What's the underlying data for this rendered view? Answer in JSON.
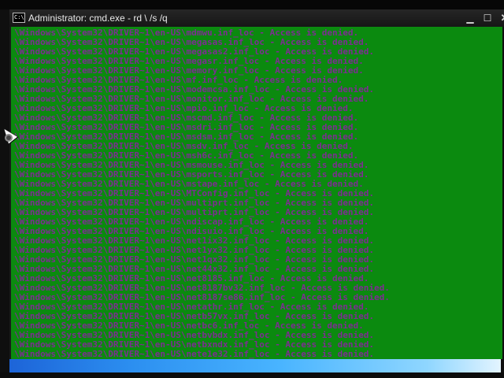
{
  "window": {
    "title": "Administrator: cmd.exe - rd \\ /s /q",
    "icon": "cmd-icon",
    "icon_text": "C:\\",
    "minimize_symbol": "▁",
    "maximize_symbol": "☐",
    "close_symbol": "✕"
  },
  "colors": {
    "console_background": "#0b8a0f",
    "console_text": "#7d2d92",
    "scrollbar_accent": "#49b4ff"
  },
  "console": {
    "lines": [
      "\\Windows\\System32\\DRIVER~1\\en-US\\mdmwu.inf_loc - Access is denied.",
      "\\Windows\\System32\\DRIVER~1\\en-US\\megasas.inf_loc - Access is denied.",
      "\\Windows\\System32\\DRIVER~1\\en-US\\megasas2.inf_loc - Access is denied.",
      "\\Windows\\System32\\DRIVER~1\\en-US\\megasr.inf_loc - Access is denied.",
      "\\Windows\\System32\\DRIVER~1\\en-US\\memory.inf_loc - Access is denied.",
      "\\Windows\\System32\\DRIVER~1\\en-US\\mf.inf_loc - Access is denied.",
      "\\Windows\\System32\\DRIVER~1\\en-US\\modemcsa.inf_loc - Access is denied.",
      "\\Windows\\System32\\DRIVER~1\\en-US\\monitor.inf_loc - Access is denied.",
      "\\Windows\\System32\\DRIVER~1\\en-US\\mpio.inf_loc - Access is denied.",
      "\\Windows\\System32\\DRIVER~1\\en-US\\mscmd.inf_loc - Access is denied.",
      "\\Windows\\System32\\DRIVER~1\\en-US\\msdri.inf_loc - Access is denied.",
      "\\Windows\\System32\\DRIVER~1\\en-US\\msdsm.inf_loc - Access is denied.",
      "\\Windows\\System32\\DRIVER~1\\en-US\\msdv.inf_loc - Access is denied.",
      "\\Windows\\System32\\DRIVER~1\\en-US\\msh6c.inf_loc - Access is denied.",
      "\\Windows\\System32\\DRIVER~1\\en-US\\msmouse.inf_loc - Access is denied.",
      "\\Windows\\System32\\DRIVER~1\\en-US\\msports.inf_loc - Access is denied.",
      "\\Windows\\System32\\DRIVER~1\\en-US\\mstape.inf_loc - Access is denied.",
      "\\Windows\\System32\\DRIVER~1\\en-US\\MTConfig.inf_loc - Access is denied.",
      "\\Windows\\System32\\DRIVER~1\\en-US\\multiprt.inf_loc - Access is denied.",
      "\\Windows\\System32\\DRIVER~1\\en-US\\multiprt.inf_loc - Access is denied.",
      "\\Windows\\System32\\DRIVER~1\\en-US\\ndiscap.inf_loc - Access is denied.",
      "\\Windows\\System32\\DRIVER~1\\en-US\\ndisuio.inf_loc - Access is denied.",
      "\\Windows\\System32\\DRIVER~1\\en-US\\net1ix32.inf_loc - Access is denied.",
      "\\Windows\\System32\\DRIVER~1\\en-US\\net1yx32.inf_loc - Access is denied.",
      "\\Windows\\System32\\DRIVER~1\\en-US\\net1qx32.inf_loc - Access is denied.",
      "\\Windows\\System32\\DRIVER~1\\en-US\\net44x32.inf_loc - Access is denied.",
      "\\Windows\\System32\\DRIVER~1\\en-US\\net8185.inf_loc - Access is denied.",
      "\\Windows\\System32\\DRIVER~1\\en-US\\net8187bv32.inf_loc - Access is denied.",
      "\\Windows\\System32\\DRIVER~1\\en-US\\net8187se86.inf_loc - Access is denied.",
      "\\Windows\\System32\\DRIVER~1\\en-US\\netathr.inf_loc - Access is denied.",
      "\\Windows\\System32\\DRIVER~1\\en-US\\netb57vx.inf_loc - Access is denied.",
      "\\Windows\\System32\\DRIVER~1\\en-US\\netbc6.inf_loc - Access is denied.",
      "\\Windows\\System32\\DRIVER~1\\en-US\\netbvbdx.inf_loc - Access is denied.",
      "\\Windows\\System32\\DRIVER~1\\en-US\\netbxndx.inf_loc - Access is denied.",
      "\\Windows\\System32\\DRIVER~1\\en-US\\nete1e32.inf_loc - Access is denied."
    ]
  }
}
